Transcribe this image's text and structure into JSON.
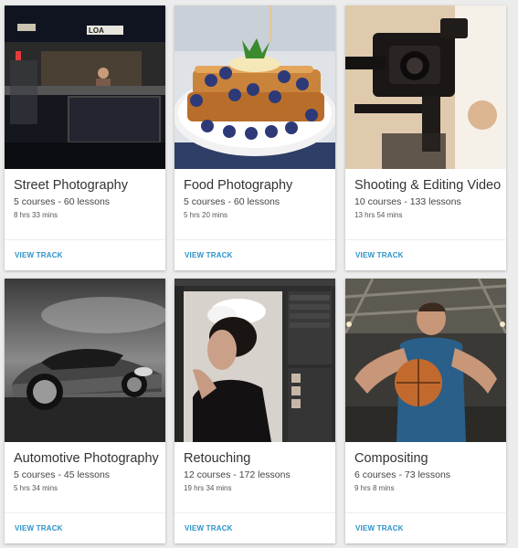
{
  "tracks": [
    {
      "title": "Street Photography",
      "counts": "5 courses - 60 lessons",
      "duration": "8 hrs 33 mins",
      "action": "VIEW TRACK",
      "sign_text": "LOA"
    },
    {
      "title": "Food Photography",
      "counts": "5 courses - 60 lessons",
      "duration": "5 hrs 20 mins",
      "action": "VIEW TRACK"
    },
    {
      "title": "Shooting & Editing Video",
      "counts": "10 courses - 133 lessons",
      "duration": "13 hrs 54 mins",
      "action": "VIEW TRACK"
    },
    {
      "title": "Automotive Photography",
      "counts": "5 courses - 45 lessons",
      "duration": "5 hrs 34 mins",
      "action": "VIEW TRACK"
    },
    {
      "title": "Retouching",
      "counts": "12 courses - 172 lessons",
      "duration": "19 hrs 34 mins",
      "action": "VIEW TRACK"
    },
    {
      "title": "Compositing",
      "counts": "6 courses - 73 lessons",
      "duration": "9 hrs 8 mins",
      "action": "VIEW TRACK"
    }
  ],
  "colors": {
    "link": "#2a93c9",
    "page_background": "#ececec",
    "card_background": "#ffffff"
  }
}
